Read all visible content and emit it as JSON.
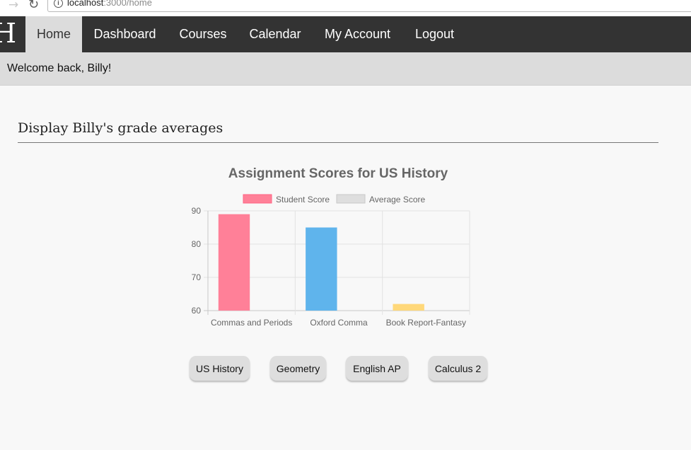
{
  "browser": {
    "url_host": "localhost",
    "url_path": ":3000/home"
  },
  "nav": {
    "logo": "H",
    "items": [
      {
        "label": "Home",
        "active": true
      },
      {
        "label": "Dashboard",
        "active": false
      },
      {
        "label": "Courses",
        "active": false
      },
      {
        "label": "Calendar",
        "active": false
      },
      {
        "label": "My Account",
        "active": false
      },
      {
        "label": "Logout",
        "active": false
      }
    ]
  },
  "welcome": {
    "text": "Welcome back, Billy!"
  },
  "section": {
    "title": "Display Billy's grade averages"
  },
  "chart_data": {
    "type": "bar",
    "title": "Assignment Scores for US History",
    "categories": [
      "Commas and Periods",
      "Oxford Comma",
      "Book Report-Fantasy"
    ],
    "series": [
      {
        "name": "Student Score",
        "values": [
          89,
          85,
          62
        ],
        "colors": [
          "#ff8098",
          "#5fb4ec",
          "#ffd87a"
        ],
        "legend_color": "#ff8098"
      },
      {
        "name": "Average Score",
        "values": [
          null,
          null,
          null
        ],
        "legend_color": "#dedede"
      }
    ],
    "ylim": [
      60,
      90
    ],
    "yticks": [
      60,
      70,
      80,
      90
    ],
    "grid": true,
    "legend_position": "top"
  },
  "courses": [
    "US History",
    "Geometry",
    "English AP",
    "Calculus 2"
  ]
}
